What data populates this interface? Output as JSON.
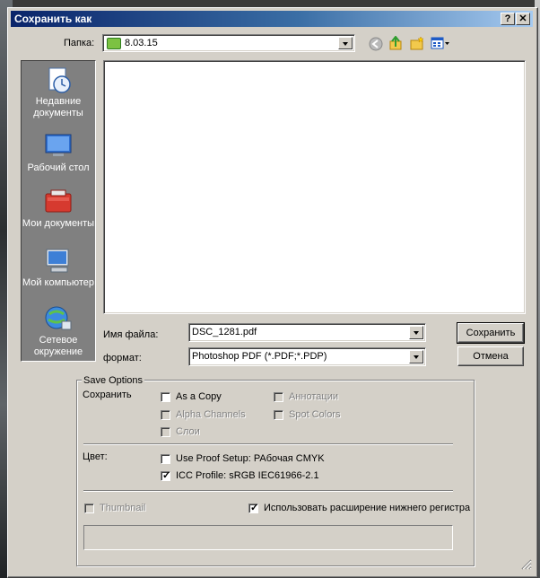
{
  "window": {
    "title": "Сохранить как",
    "help_label": "?",
    "close_label": "✕"
  },
  "toolbar": {
    "folder_label": "Папка:",
    "folder_value": "8.03.15"
  },
  "places": [
    {
      "label": "Недавние документы",
      "icon": "recent-documents-icon"
    },
    {
      "label": "Рабочий стол",
      "icon": "desktop-icon"
    },
    {
      "label": "Мои документы",
      "icon": "my-documents-icon"
    },
    {
      "label": "Мой компьютер",
      "icon": "my-computer-icon"
    },
    {
      "label": "Сетевое окружение",
      "icon": "network-icon"
    }
  ],
  "filename": {
    "label": "Имя файла:",
    "value": "DSC_1281.pdf"
  },
  "format": {
    "label": "формат:",
    "value": "Photoshop PDF (*.PDF;*.PDP)"
  },
  "buttons": {
    "save": "Сохранить",
    "cancel": "Отмена"
  },
  "save_options": {
    "title": "Save Options",
    "save_label": "Сохранить",
    "as_copy": "As a Copy",
    "annotations": "Аннотации",
    "alpha_channels": "Alpha Channels",
    "spot_colors": "Spot Colors",
    "layers": "Слои",
    "color_label": "Цвет:",
    "use_proof_setup": "Use Proof Setup:  РАбочая CMYK",
    "icc_profile": "ICC Profile:  sRGB IEC61966-2.1",
    "thumbnail": "Thumbnail",
    "lowercase_ext": "Использовать расширение нижнего регистра"
  },
  "colors": {
    "title_start": "#0a246a",
    "title_end": "#a6caf0",
    "dialog_bg": "#d4d0c8"
  }
}
